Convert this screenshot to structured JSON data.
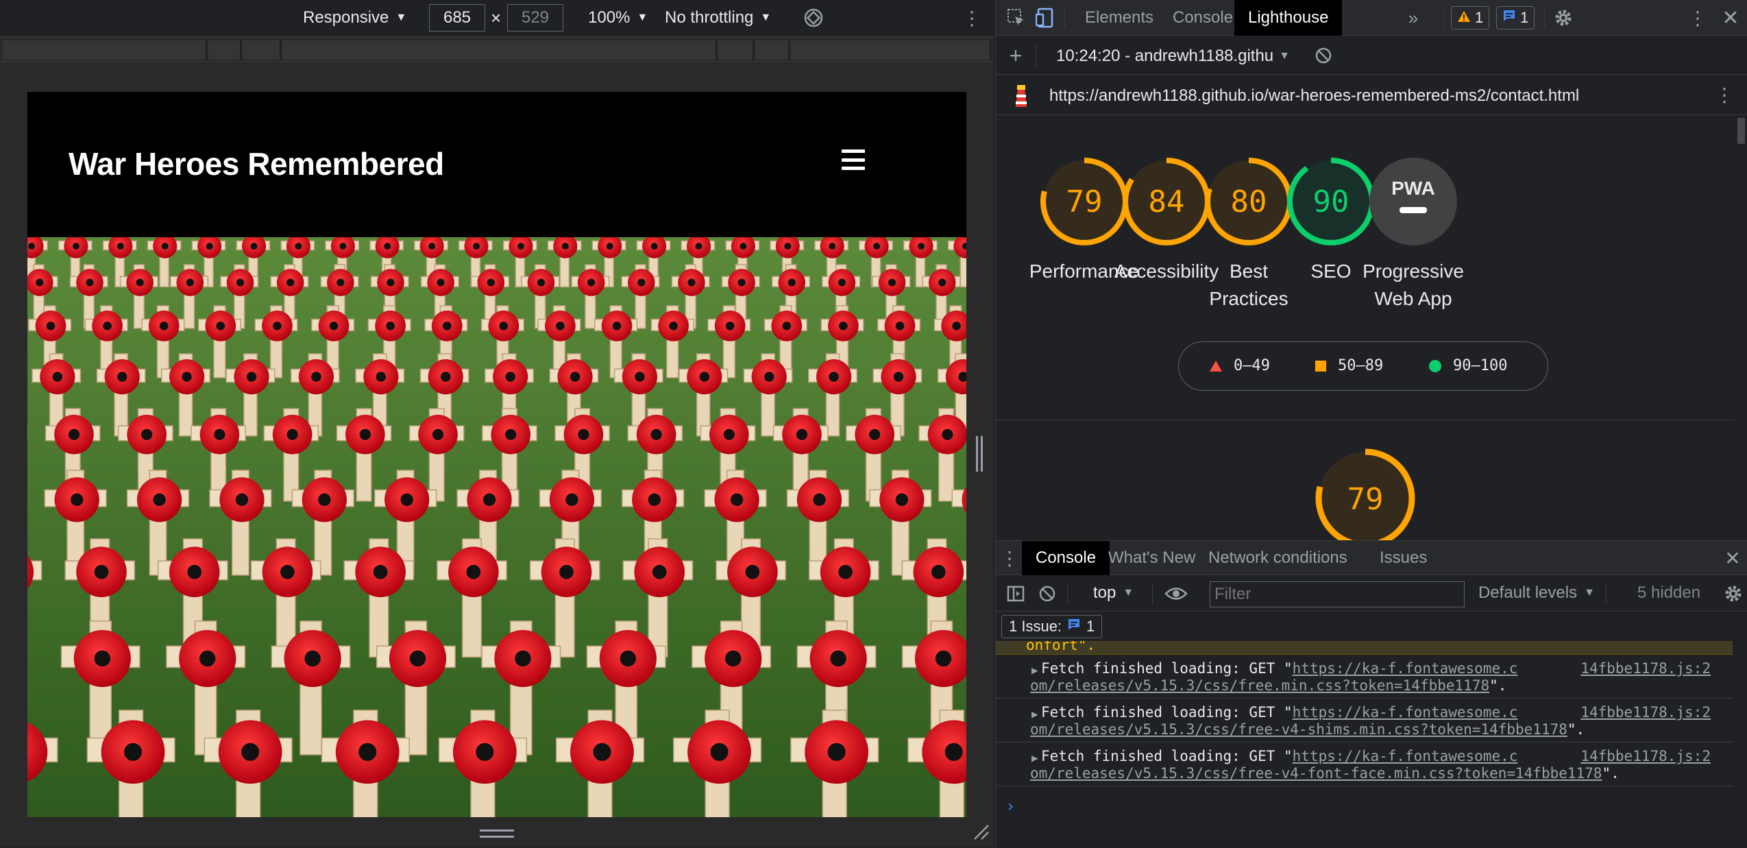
{
  "device_toolbar": {
    "device_mode": "Responsive",
    "width": "685",
    "height": "529",
    "dimension_separator": "×",
    "zoom": "100%",
    "throttling": "No throttling"
  },
  "site": {
    "title": "War Heroes Remembered",
    "hero_icon": "menu-icon"
  },
  "devtools": {
    "tabs": [
      "Elements",
      "Console",
      "Lighthouse"
    ],
    "active_tab": "Lighthouse",
    "more_tabs_icon": "»",
    "warning_count": "1",
    "issue_count": "1",
    "lighthouse_report": "10:24:20 - andrewh1188.githu",
    "report_url": "https://andrewh1188.github.io/war-heroes-remembered-ms2/contact.html",
    "scores": [
      {
        "label_lines": [
          "Performance"
        ],
        "value": "79",
        "score": 79,
        "color": "#ffa400"
      },
      {
        "label_lines": [
          "Accessibility"
        ],
        "value": "84",
        "score": 84,
        "color": "#ffa400"
      },
      {
        "label_lines": [
          "Best",
          "Practices"
        ],
        "value": "80",
        "score": 80,
        "color": "#ffa400"
      },
      {
        "label_lines": [
          "SEO"
        ],
        "value": "90",
        "score": 90,
        "color": "#0cce6b"
      },
      {
        "label_lines": [
          "Progressive",
          "Web App"
        ],
        "value": "PWA",
        "score": null,
        "color": "#9aa0a6"
      }
    ],
    "legend": [
      {
        "range": "0–49",
        "color": "#ff4e42",
        "shape": "triangle"
      },
      {
        "range": "50–89",
        "color": "#ffa400",
        "shape": "square"
      },
      {
        "range": "90–100",
        "color": "#0cce6b",
        "shape": "circle"
      }
    ],
    "performance_section_score": "79"
  },
  "drawer": {
    "tabs": [
      "Console",
      "What's New",
      "Network conditions",
      "Issues"
    ],
    "active_tab": "Console",
    "context": "top",
    "filter_placeholder": "Filter",
    "levels": "Default levels",
    "hidden": "5 hidden",
    "issues_label": "1 Issue:",
    "issues_count": "1",
    "warning_tail": "onfort\".",
    "messages": [
      {
        "prefix": "Fetch finished loading: GET \"",
        "link_a": "https://ka-f.fontawesome.c",
        "link_b": "om/releases/v5.15.3/css/free.min.css?token=14fbbe1178",
        "suffix": "\".",
        "source": "14fbbe1178.js:2"
      },
      {
        "prefix": "Fetch finished loading: GET \"",
        "link_a": "https://ka-f.fontawesome.c",
        "link_b": "om/releases/v5.15.3/css/free-v4-shims.min.css?token=14fbbe1178",
        "suffix": "\".",
        "source": "14fbbe1178.js:2"
      },
      {
        "prefix": "Fetch finished loading: GET \"",
        "link_a": "https://ka-f.fontawesome.c",
        "link_b": "om/releases/v5.15.3/css/free-v4-font-face.min.css?token=14fbbe1178",
        "suffix": "\".",
        "source": "14fbbe1178.js:2"
      }
    ],
    "prompt": "›"
  }
}
